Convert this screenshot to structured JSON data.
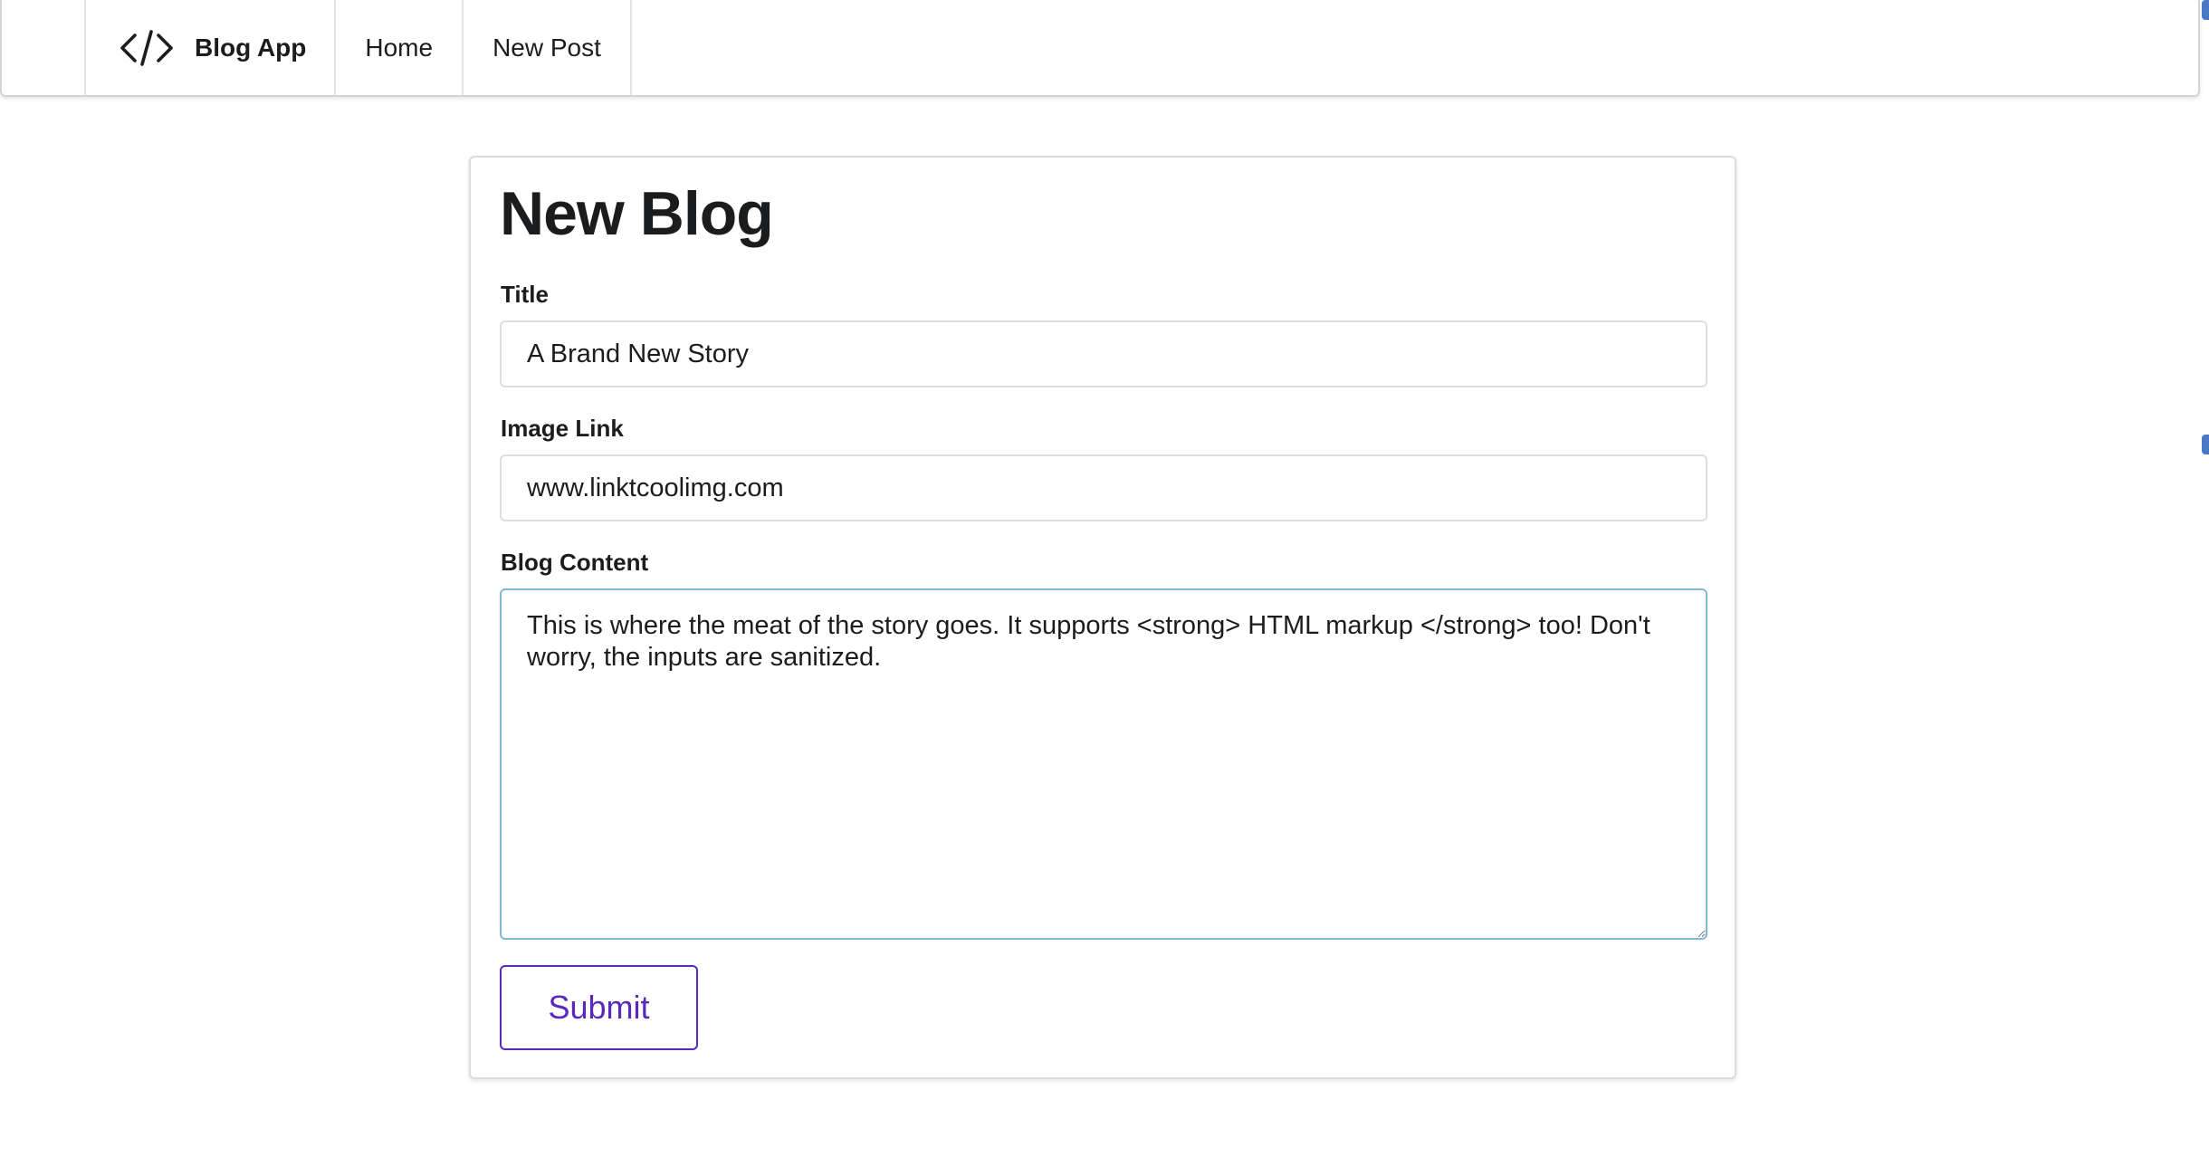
{
  "nav": {
    "brand_icon": "code-icon",
    "brand_label": "Blog App",
    "home_label": "Home",
    "new_post_label": "New Post"
  },
  "form": {
    "title": "New Blog",
    "title_field": {
      "label": "Title",
      "value": "A Brand New Story"
    },
    "image_field": {
      "label": "Image Link",
      "value": "www.linktcoolimg.com"
    },
    "content_field": {
      "label": "Blog Content",
      "value": "This is where the meat of the story goes. It supports <strong> HTML markup </strong> too! Don't worry, the inputs are sanitized. "
    },
    "submit_label": "Submit"
  },
  "colors": {
    "accent": "#5829bb",
    "focus_border": "#85b7d9",
    "border": "#dedede"
  }
}
